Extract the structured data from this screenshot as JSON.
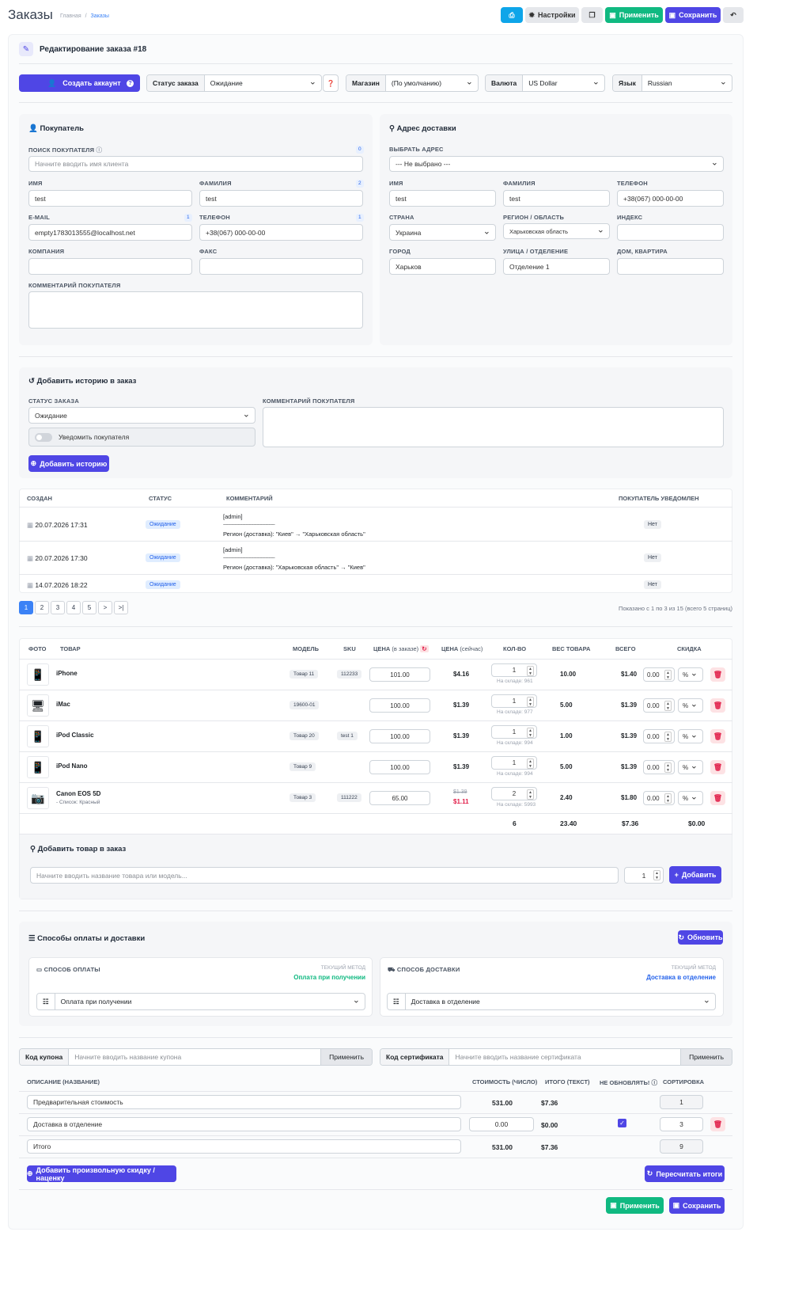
{
  "header": {
    "title": "Заказы",
    "crumb_home": "Главная",
    "crumb_sep": "/",
    "crumb_current": "Заказы",
    "btn_settings": "Настройки",
    "btn_apply": "Применить",
    "btn_save": "Сохранить"
  },
  "panel": {
    "title": "Редактирование заказа #18"
  },
  "topbar": {
    "create_account": "Создать аккаунт",
    "status_label": "Статус заказа",
    "status_value": "Ожидание",
    "store_label": "Магазин",
    "store_value": "(По умолчанию)",
    "currency_label": "Валюта",
    "currency_value": "US Dollar",
    "lang_label": "Язык",
    "lang_value": "Russian"
  },
  "buyer": {
    "title": "Покупатель",
    "search_label": "ПОИСК ПОКУПАТЕЛЯ",
    "search_count": "0",
    "search_ph": "Начните вводить имя клиента",
    "fname_label": "ИМЯ",
    "fname": "test",
    "lname_label": "ФАМИЛИЯ",
    "lname_count": "2",
    "lname": "test",
    "email_label": "E-MAIL",
    "email_count": "1",
    "email": "empty1783013555@localhost.net",
    "phone_label": "ТЕЛЕФОН",
    "phone_count": "1",
    "phone": "+38(067) 000-00-00",
    "company_label": "КОМПАНИЯ",
    "fax_label": "ФАКС",
    "comment_label": "КОММЕНТАРИЙ ПОКУПАТЕЛЯ"
  },
  "ship": {
    "title": "Адрес доставки",
    "addr_label": "ВЫБРАТЬ АДРЕС",
    "addr_value": "--- Не выбрано ---",
    "fname_label": "ИМЯ",
    "fname": "test",
    "lname_label": "ФАМИЛИЯ",
    "lname": "test",
    "phone_label": "ТЕЛЕФОН",
    "phone": "+38(067) 000-00-00",
    "country_label": "СТРАНА",
    "country": "Украина",
    "region_label": "РЕГИОН / ОБЛАСТЬ",
    "region": "Харьковская область",
    "zip_label": "ИНДЕКС",
    "city_label": "ГОРОД",
    "city": "Харьков",
    "street_label": "УЛИЦА / ОТДЕЛЕНИЕ",
    "street": "Отделение 1",
    "house_label": "ДОМ, КВАРТИРА"
  },
  "history": {
    "title": "Добавить историю в заказ",
    "status_label": "СТАТУС ЗАКАЗА",
    "status_value": "Ожидание",
    "notify": "Уведомить покупателя",
    "comment_label": "КОММЕНТАРИЙ ПОКУПАТЕЛЯ",
    "add_btn": "Добавить историю",
    "cols": [
      "СОЗДАН",
      "СТАТУС",
      "КОММЕНТАРИЙ",
      "ПОКУПАТЕЛЬ УВЕДОМЛЕН"
    ],
    "rows": [
      {
        "date": "20.07.2026 17:31",
        "status": "Ожидание",
        "c1": "[admin]",
        "c2": "--------------------------------------------------------",
        "c3": "Регион (доставка): \"Киев\" → \"Харьковская область\"",
        "notified": "Нет"
      },
      {
        "date": "20.07.2026 17:30",
        "status": "Ожидание",
        "c1": "[admin]",
        "c2": "--------------------------------------------------------",
        "c3": "Регион (доставка): \"Харьковская область\" → \"Киев\"",
        "notified": "Нет"
      },
      {
        "date": "14.07.2026 18:22",
        "status": "Ожидание",
        "c1": "",
        "c2": "",
        "c3": "",
        "notified": "Нет"
      }
    ],
    "pages": [
      "1",
      "2",
      "3",
      "4",
      "5",
      ">",
      ">|"
    ],
    "shown": "Показано с 1 по 3 из 15 (всего 5 страниц)"
  },
  "products": {
    "cols": {
      "photo": "ФОТО",
      "name": "ТОВАР",
      "model": "МОДЕЛЬ",
      "sku": "SKU",
      "price_order": "ЦЕНА",
      "price_order_note": "(в заказе)",
      "price_now": "ЦЕНА",
      "price_now_note": "(сейчас)",
      "qty": "КОЛ-ВО",
      "weight": "ВЕС ТОВАРА",
      "total": "ВСЕГО",
      "discount": "СКИДКА"
    },
    "rows": [
      {
        "name": "iPhone",
        "option": "",
        "model": "Товар 11",
        "sku": "112233",
        "price": "101.00",
        "now": "$4.16",
        "old": "",
        "qty": "1",
        "stock": "На складе: 961",
        "weight": "10.00",
        "total": "$1.40",
        "disc": "0.00",
        "unit": "%"
      },
      {
        "name": "iMac",
        "option": "",
        "model": "19600-01",
        "sku": "",
        "price": "100.00",
        "now": "$1.39",
        "old": "",
        "qty": "1",
        "stock": "На складе: 977",
        "weight": "5.00",
        "total": "$1.39",
        "disc": "0.00",
        "unit": "%"
      },
      {
        "name": "iPod Classic",
        "option": "",
        "model": "Товар 20",
        "sku": "test 1",
        "price": "100.00",
        "now": "$1.39",
        "old": "",
        "qty": "1",
        "stock": "На складе: 994",
        "weight": "1.00",
        "total": "$1.39",
        "disc": "0.00",
        "unit": "%"
      },
      {
        "name": "iPod Nano",
        "option": "",
        "model": "Товар 9",
        "sku": "",
        "price": "100.00",
        "now": "$1.39",
        "old": "",
        "qty": "1",
        "stock": "На складе: 994",
        "weight": "5.00",
        "total": "$1.39",
        "disc": "0.00",
        "unit": "%"
      },
      {
        "name": "Canon EOS 5D",
        "option": "- Список: Красный",
        "model": "Товар 3",
        "sku": "111222",
        "price": "65.00",
        "now": "$1.11",
        "old": "$1.39",
        "qty": "2",
        "stock": "На складе: 5993",
        "weight": "2.40",
        "total": "$1.80",
        "disc": "0.00",
        "unit": "%"
      }
    ],
    "sum_qty": "6",
    "sum_weight": "23.40",
    "sum_total": "$7.36",
    "sum_disc": "$0.00",
    "add_title": "Добавить товар в заказ",
    "add_ph": "Начните вводить название товара или модель...",
    "add_qty": "1",
    "add_btn": "Добавить"
  },
  "methods": {
    "title": "Способы оплаты и доставки",
    "refresh": "Обновить",
    "pay_title": "СПОСОБ ОПЛАТЫ",
    "cur_label": "ТЕКУЩИЙ МЕТОД",
    "pay_current": "Оплата при получении",
    "pay_value": "Оплата при получении",
    "ship_title": "СПОСОБ ДОСТАВКИ",
    "ship_cur_label": "ТЕКУЩИЙ МЕТОД",
    "ship_current": "Доставка в отделение",
    "ship_value": "Доставка в отделение"
  },
  "coupon": {
    "label": "Код купона",
    "ph": "Начните вводить название купона",
    "btn": "Применить",
    "cert_label": "Код сертификата",
    "cert_ph": "Начните вводить название сертификата",
    "cert_btn": "Применить"
  },
  "totals": {
    "cols": [
      "ОПИСАНИЕ (НАЗВАНИЕ)",
      "СТОИМОСТЬ (ЧИСЛО)",
      "ИТОГО (ТЕКСТ)",
      "НЕ ОБНОВЛЯТЬ!",
      "СОРТИРОВКА"
    ],
    "rows": [
      {
        "name": "Предварительная стоимость",
        "value": "531.00",
        "text": "$7.36",
        "sort": "1"
      },
      {
        "name": "Доставка в отделение",
        "value": "0.00",
        "text": "$0.00",
        "sort": "3"
      },
      {
        "name": "Итого",
        "value": "531.00",
        "text": "$7.36",
        "sort": "9"
      }
    ],
    "add_discount": "Добавить произвольную скидку / наценку",
    "recalc": "Пересчитать итоги",
    "apply": "Применить",
    "save": "Сохранить"
  },
  "colors": {
    "indigo": "#4f46e5",
    "green": "#10b981",
    "cyan": "#0ea5e9",
    "red": "#e11d48"
  }
}
